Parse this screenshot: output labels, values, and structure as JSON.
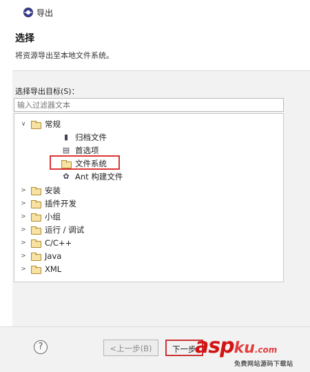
{
  "window": {
    "title": "导出"
  },
  "wizard": {
    "title": "选择",
    "description": "将资源导出至本地文件系统。",
    "target_label": "选择导出目标(S)：",
    "filter_placeholder": "输入过滤器文本"
  },
  "tree": {
    "general": {
      "label": "常规",
      "expanded": true
    },
    "general_children": [
      {
        "label": "归档文件",
        "icon": "archive-icon"
      },
      {
        "label": "首选项",
        "icon": "preferences-icon"
      },
      {
        "label": "文件系统",
        "icon": "folder-icon",
        "selected": true
      },
      {
        "label": "Ant 构建文件",
        "icon": "ant-icon"
      }
    ],
    "categories": [
      {
        "label": "安装"
      },
      {
        "label": "插件开发"
      },
      {
        "label": "小组"
      },
      {
        "label": "运行 / 调试"
      },
      {
        "label": "C/C++"
      },
      {
        "label": "Java"
      },
      {
        "label": "XML"
      }
    ]
  },
  "footer": {
    "help_label": "?",
    "back_label": "<上一步(B)",
    "next_label": "下一步"
  },
  "watermark": {
    "asp": "asp",
    "ku": "ku",
    "tail": ".com",
    "sub": "免费网站源码下载站"
  },
  "colors": {
    "highlight": "#dd3333",
    "watermark": "#d21414"
  }
}
